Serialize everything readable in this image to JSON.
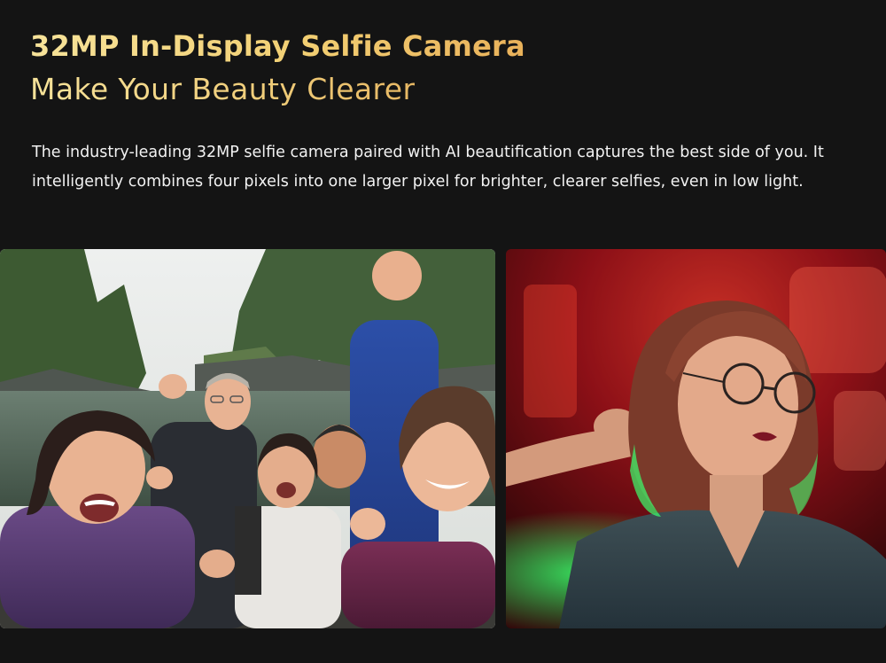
{
  "section": {
    "title": "32MP In-Display Selfie Camera",
    "subtitle": "Make Your Beauty Clearer",
    "description": "The industry-leading 32MP selfie camera paired with AI beautification captures the best side of you. It intelligently combines four pixels into one larger pixel for brighter, clearer selfies, even in low light."
  },
  "colors": {
    "background": "#141414",
    "title_gold": "#f2cf73",
    "body_text": "#f2f2f2"
  }
}
